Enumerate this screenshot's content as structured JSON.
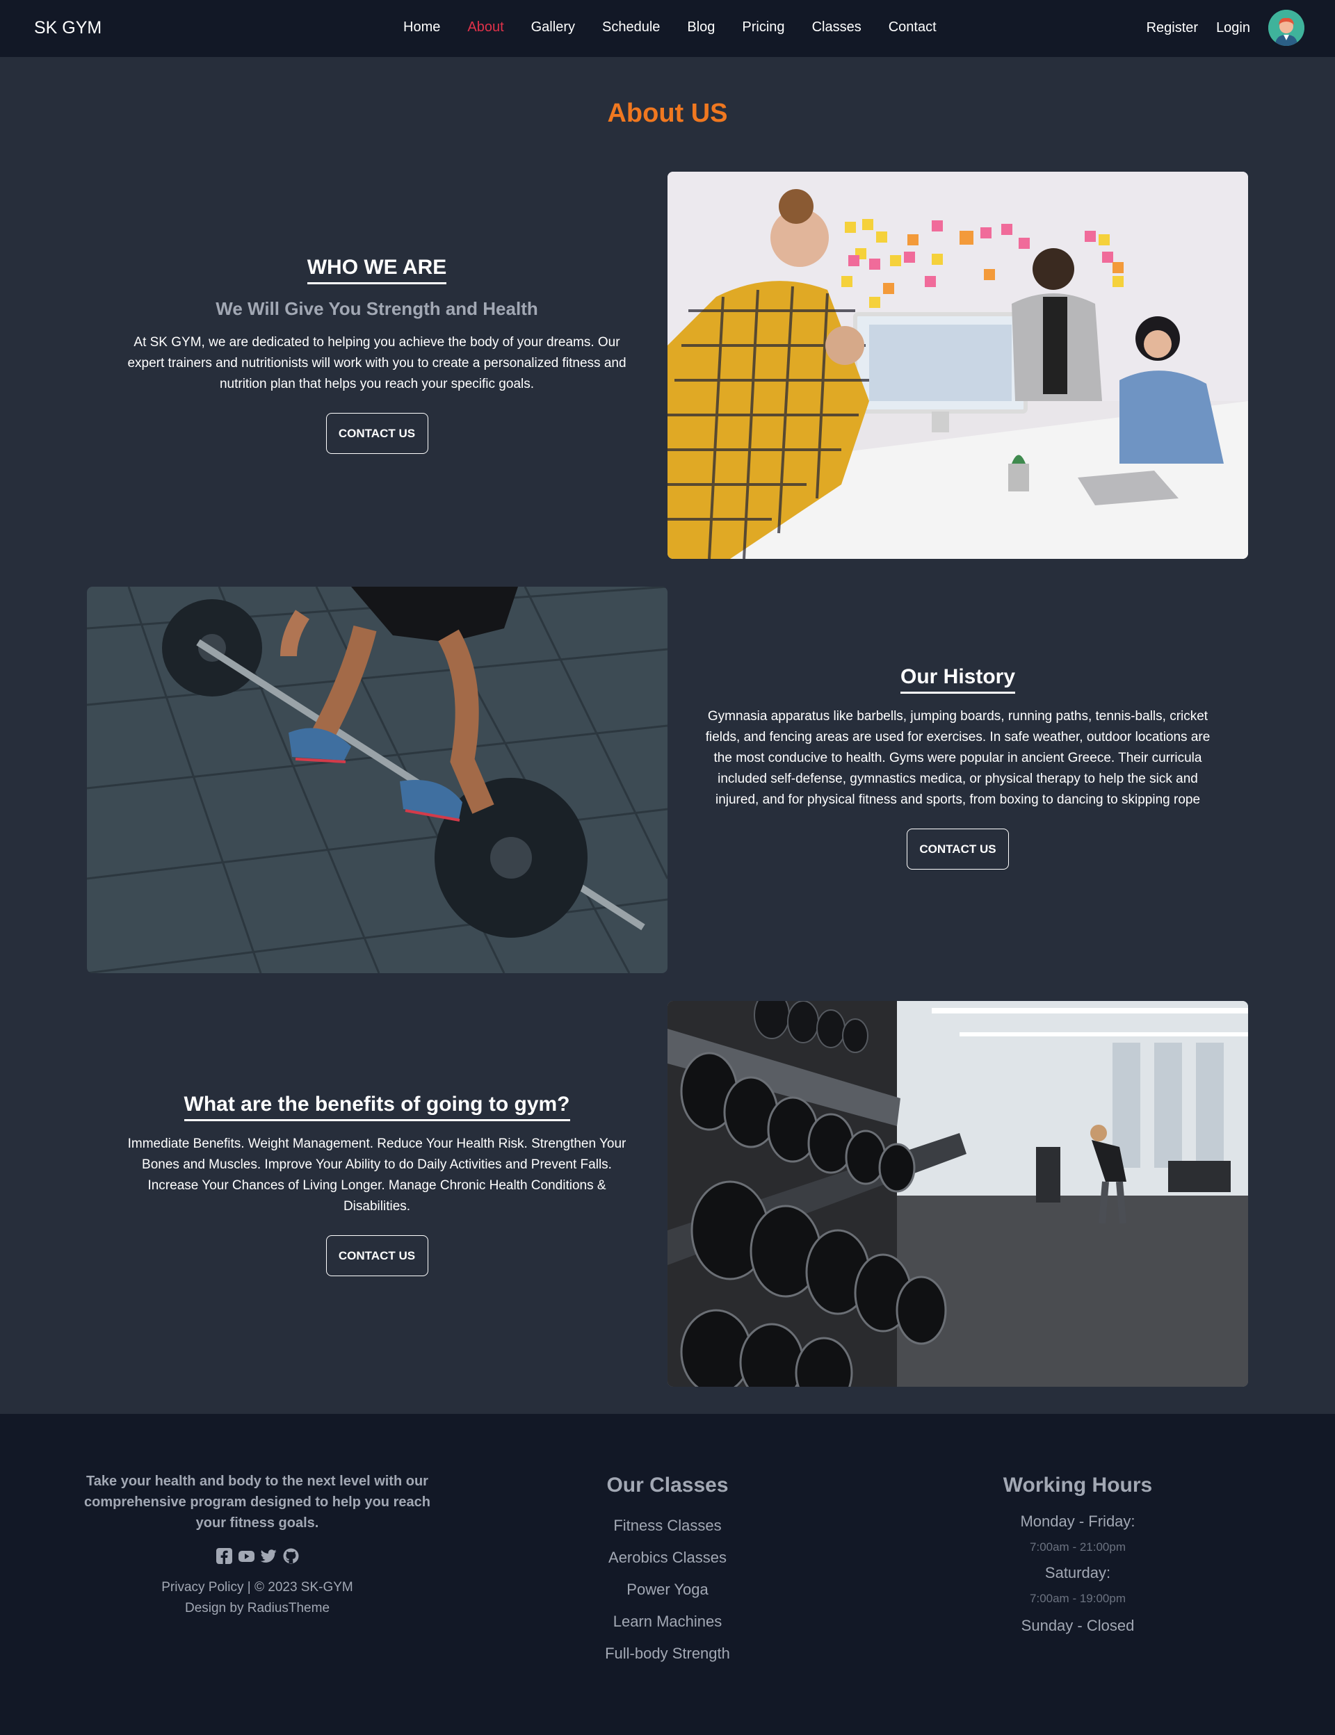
{
  "nav": {
    "brand": "SK GYM",
    "links": [
      "Home",
      "About",
      "Gallery",
      "Schedule",
      "Blog",
      "Pricing",
      "Classes",
      "Contact"
    ],
    "register": "Register",
    "login": "Login",
    "active_color": "#e0324a"
  },
  "page": {
    "title": "About US",
    "title_color": "#f07820"
  },
  "who": {
    "heading": "WHO WE ARE",
    "subheading": "We Will Give You Strength and Health",
    "body": "At SK GYM, we are dedicated to helping you achieve the body of your dreams. Our expert trainers and nutritionists will work with you to create a personalized fitness and nutrition plan that helps you reach your specific goals.",
    "button": "CONTACT US"
  },
  "history": {
    "heading": "Our History",
    "body": "Gymnasia apparatus like barbells, jumping boards, running paths, tennis-balls, cricket fields, and fencing areas are used for exercises. In safe weather, outdoor locations are the most conducive to health. Gyms were popular in ancient Greece. Their curricula included self-defense, gymnastics medica, or physical therapy to help the sick and injured, and for physical fitness and sports, from boxing to dancing to skipping rope",
    "button": "CONTACT US"
  },
  "benefits": {
    "heading": "What are the benefits of going to gym?",
    "body": "Immediate Benefits. Weight Management. Reduce Your Health Risk. Strengthen Your Bones and Muscles. Improve Your Ability to do Daily Activities and Prevent Falls. Increase Your Chances of Living Longer. Manage Chronic Health Conditions & Disabilities.",
    "button": "CONTACT US"
  },
  "footer": {
    "tagline": "Take your health and body to the next level with our comprehensive program designed to help you reach your fitness goals.",
    "social_icons": [
      "facebook-icon",
      "youtube-icon",
      "twitter-icon",
      "github-icon"
    ],
    "legal": "Privacy Policy | © 2023 SK-GYM",
    "credit": "Design by RadiusTheme",
    "classes_heading": "Our Classes",
    "classes": [
      "Fitness Classes",
      "Aerobics Classes",
      "Power Yoga",
      "Learn Machines",
      "Full-body Strength"
    ],
    "hours_heading": "Working Hours",
    "hours": {
      "weekday_label": "Monday - Friday:",
      "weekday_time": "7:00am - 21:00pm",
      "saturday_label": "Saturday:",
      "saturday_time": "7:00am - 19:00pm",
      "sunday": "Sunday - Closed"
    }
  }
}
